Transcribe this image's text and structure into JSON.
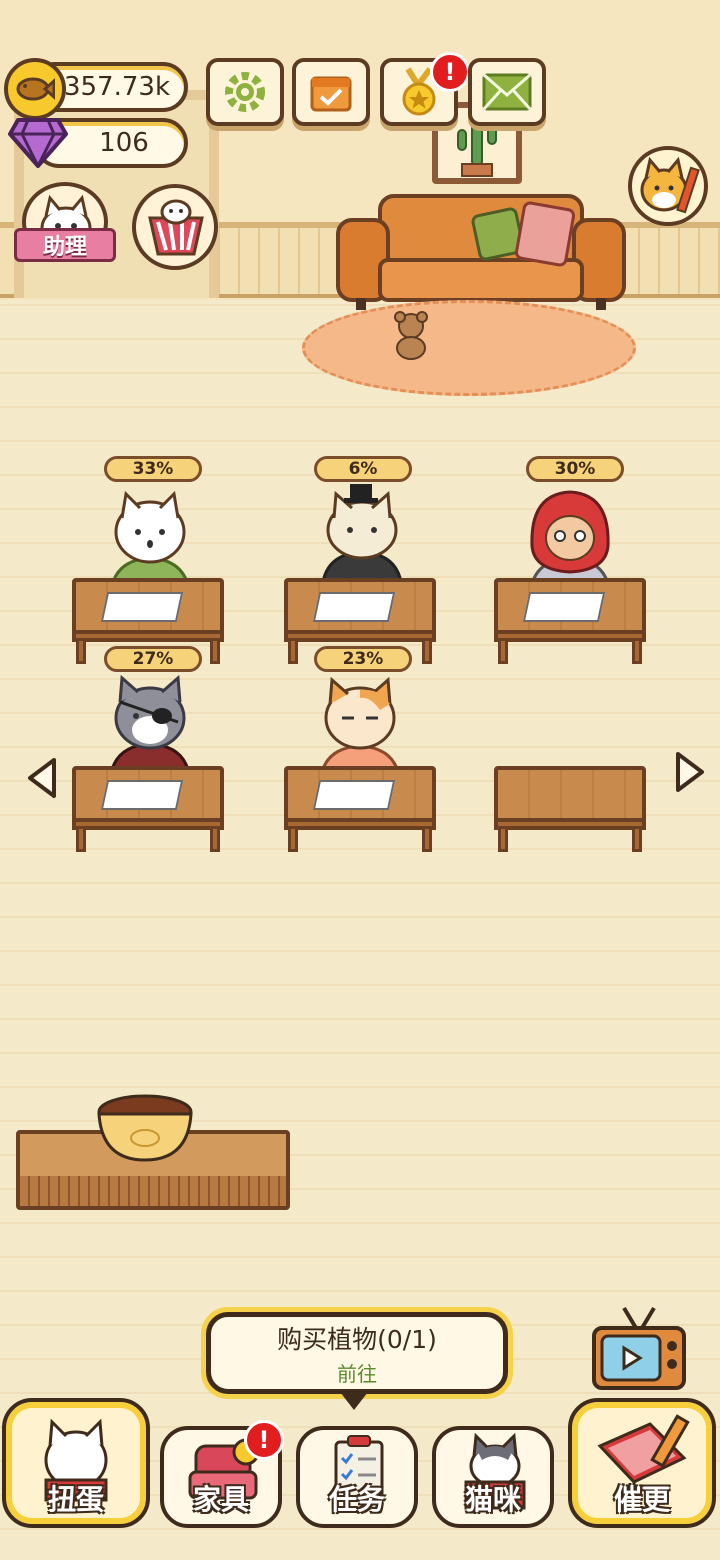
{
  "hud": {
    "coins": "357.73k",
    "gems": "106",
    "assistant_label": "助理",
    "mail_badge": "!",
    "medal_badge": "!"
  },
  "desks": [
    {
      "progress": "33%"
    },
    {
      "progress": "6%"
    },
    {
      "progress": "30%"
    },
    {
      "progress": "27%"
    },
    {
      "progress": "23%"
    }
  ],
  "task_tip": {
    "title": "购买植物(0/1)",
    "action": "前往"
  },
  "nav": {
    "gacha": "扭蛋",
    "furniture": "家具",
    "furniture_badge": "!",
    "tasks": "任务",
    "cats": "猫咪",
    "urge": "催更"
  },
  "colors": {
    "accent": "#f7cf3b",
    "outline": "#3f2b1c",
    "alert": "#e11d1d"
  }
}
